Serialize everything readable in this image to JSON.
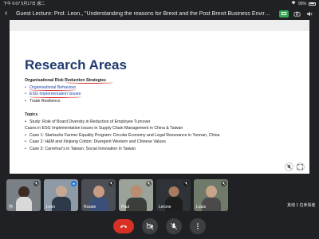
{
  "status": {
    "time": "下午 6:07",
    "date": "5月17日 週二",
    "battery": "95%"
  },
  "meeting": {
    "title": "Guest Lecture: Prof. Leon., \"Understanding the reasons for Brexit and the Post Brexit Business Environ..."
  },
  "slide": {
    "heading": "Research Areas",
    "lines": [
      {
        "text": "Organisational Risk Reduction Strategies",
        "style": "sub"
      },
      {
        "text": "Organisational Behaviour",
        "style": "bul-link"
      },
      {
        "text": "ESG Implementation Issues",
        "style": "bul-link"
      },
      {
        "text": "Trade Resilience",
        "style": "bul"
      },
      {
        "text": "",
        "style": "gap"
      },
      {
        "text": "Topics",
        "style": "sub"
      },
      {
        "text": "Study: Role of Board Diversity in Reduction of Employee Turnover",
        "style": "bul"
      },
      {
        "text": "Cases in ESG Implementation Issues in Supply Chain Management in China & Taiwan",
        "style": "plain"
      },
      {
        "text": "Case 1: Starbucks Farmer Equality Program: Circular Economy and Legal Resonance in Yunnan, China",
        "style": "bul"
      },
      {
        "text": "Case 2: H&M and Xinjiang Cotton: Divergent Western and Chinese Values",
        "style": "bul"
      },
      {
        "text": "Case 3: Carrefour's in Taiwan: Social Innovation in Taiwan",
        "style": "bul"
      }
    ]
  },
  "participants": [
    {
      "name": "你",
      "bg": "#7a8086",
      "mic_active": false
    },
    {
      "name": "Leon",
      "bg": "#8e9aa6",
      "mic_active": true
    },
    {
      "name": "Rossie",
      "bg": "#4b4f55",
      "mic_active": false
    },
    {
      "name": "Paul",
      "bg": "#9aa29a",
      "mic_active": false
    },
    {
      "name": "Lerone",
      "bg": "#2f3236",
      "mic_active": false
    },
    {
      "name": "Louis",
      "bg": "#6f7a6a",
      "mic_active": false
    }
  ],
  "others_label": "其他 1 位參與者",
  "colors": {
    "end_call": "#d93025",
    "present": "#34a853",
    "active_mic": "#1a73e8"
  }
}
